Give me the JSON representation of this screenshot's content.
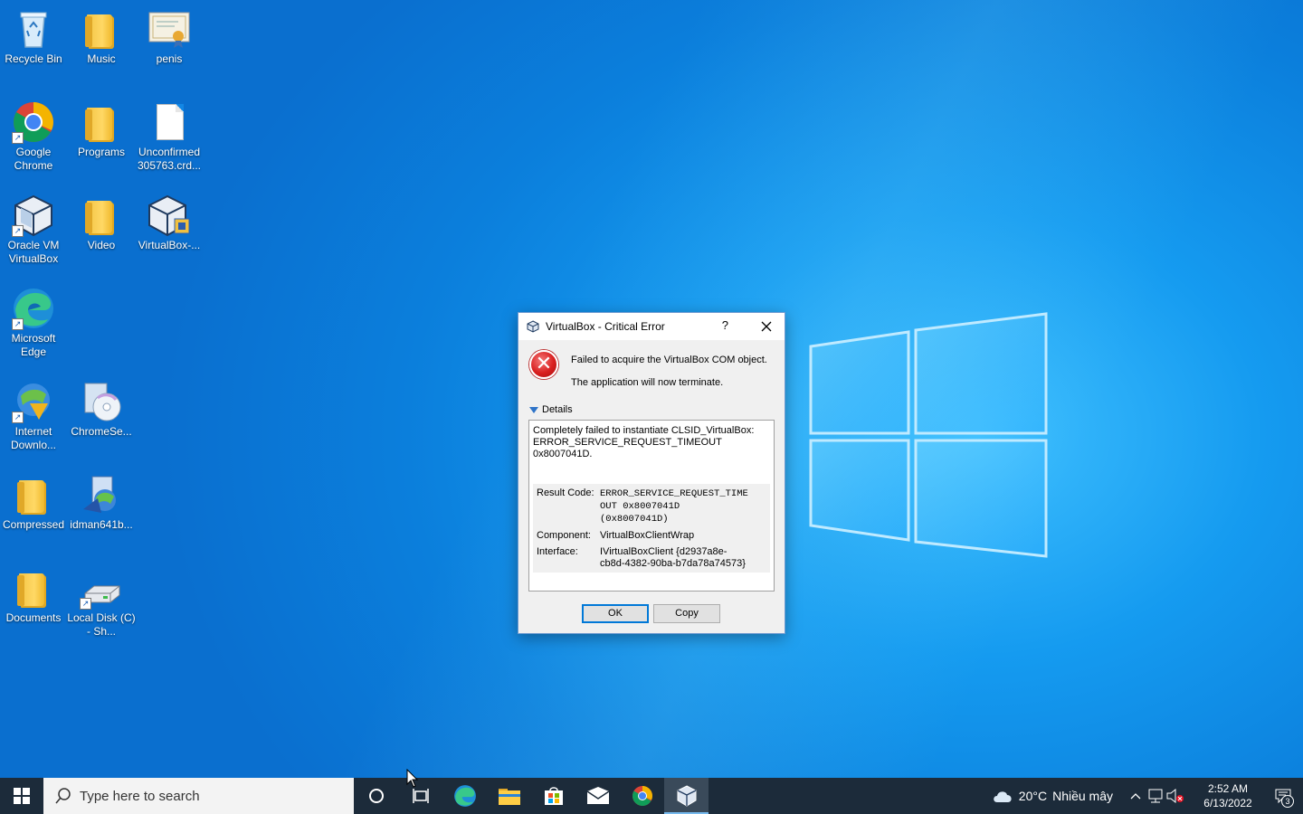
{
  "desktop": {
    "icons": [
      {
        "label": "Recycle Bin"
      },
      {
        "label": "Music"
      },
      {
        "label": "penis"
      },
      {
        "label": "Google Chrome"
      },
      {
        "label": "Programs"
      },
      {
        "label": "Unconfirmed 305763.crd..."
      },
      {
        "label": "Oracle VM VirtualBox"
      },
      {
        "label": "Video"
      },
      {
        "label": "VirtualBox-..."
      },
      {
        "label": "Microsoft Edge"
      },
      {
        "label": "Internet Downlo..."
      },
      {
        "label": "ChromeSe..."
      },
      {
        "label": "Compressed"
      },
      {
        "label": "idman641b..."
      },
      {
        "label": "Documents"
      },
      {
        "label": "Local Disk (C) - Sh..."
      }
    ]
  },
  "dialog": {
    "title": "VirtualBox - Critical Error",
    "help": "?",
    "message": "Failed to acquire the VirtualBox COM object.",
    "submessage": "The application will now terminate.",
    "details_label": "Details",
    "details_text_1": "Completely failed to instantiate CLSID_VirtualBox:",
    "details_text_2": "ERROR_SERVICE_REQUEST_TIMEOUT 0x8007041D.",
    "result_code_label": "Result Code:",
    "result_code_value_1": "ERROR_SERVICE_REQUEST_TIME",
    "result_code_value_2": "OUT 0x8007041D",
    "result_code_value_3": "(0x8007041D)",
    "component_label": "Component:",
    "component_value": "VirtualBoxClientWrap",
    "interface_label": "Interface:",
    "interface_value_1": "IVirtualBoxClient {d2937a8e-",
    "interface_value_2": "cb8d-4382-90ba-b7da78a74573}",
    "ok_label": "OK",
    "copy_label": "Copy"
  },
  "taskbar": {
    "search_placeholder": "Type here to search",
    "weather_temp": "20°C",
    "weather_desc": "Nhiều mây",
    "time": "2:52 AM",
    "date": "6/13/2022",
    "notification_count": "3"
  }
}
